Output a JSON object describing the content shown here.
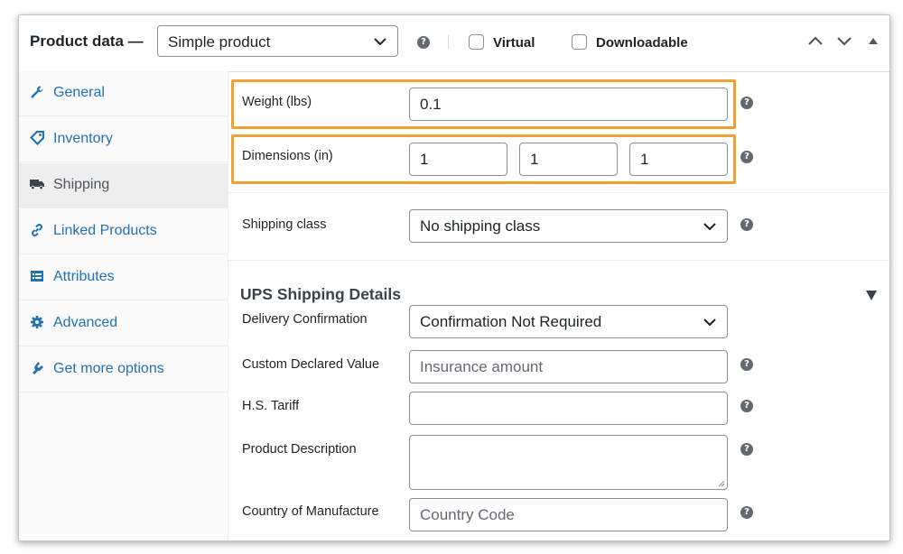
{
  "header": {
    "title": "Product data —",
    "product_type": "Simple product",
    "virtual_label": "Virtual",
    "downloadable_label": "Downloadable"
  },
  "sidebar": {
    "items": [
      {
        "label": "General",
        "icon": "wrench-icon"
      },
      {
        "label": "Inventory",
        "icon": "tag-icon"
      },
      {
        "label": "Shipping",
        "icon": "truck-icon"
      },
      {
        "label": "Linked Products",
        "icon": "link-icon"
      },
      {
        "label": "Attributes",
        "icon": "list-icon"
      },
      {
        "label": "Advanced",
        "icon": "gear-icon"
      },
      {
        "label": "Get more options",
        "icon": "plugin-icon"
      }
    ],
    "active": "Shipping"
  },
  "shipping": {
    "weight_label": "Weight (lbs)",
    "weight_value": "0.1",
    "dimensions_label": "Dimensions (in)",
    "length": "1",
    "width": "1",
    "height": "1",
    "shipping_class_label": "Shipping class",
    "shipping_class_value": "No shipping class"
  },
  "ups": {
    "title": "UPS Shipping Details",
    "delivery_label": "Delivery Confirmation",
    "delivery_value": "Confirmation Not Required",
    "declared_label": "Custom Declared Value",
    "declared_placeholder": "Insurance amount",
    "tariff_label": "H.S. Tariff",
    "tariff_value": "",
    "description_label": "Product Description",
    "description_value": "",
    "country_label": "Country of Manufacture",
    "country_placeholder": "Country Code"
  },
  "colors": {
    "highlight": "#f0a030",
    "link": "#2271b1"
  },
  "help_glyph": "?"
}
